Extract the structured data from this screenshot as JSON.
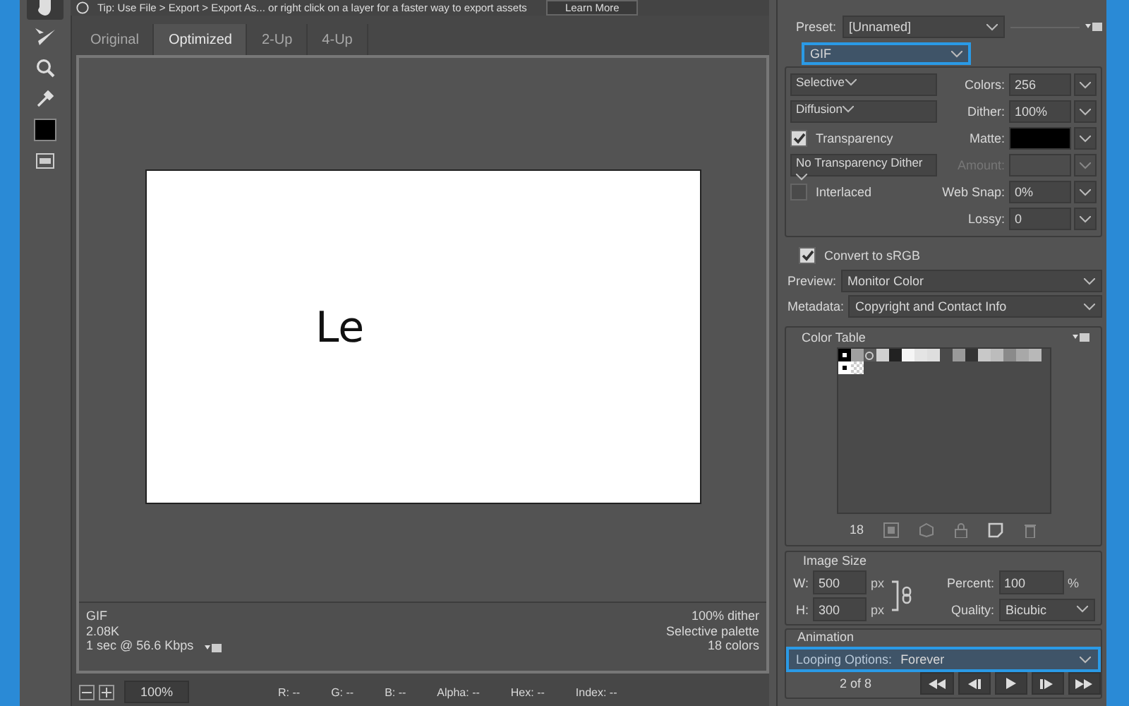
{
  "tip": {
    "text": "Tip: Use File > Export > Export As...  or right click on a layer for a faster way to export assets",
    "button": "Learn More"
  },
  "tools": [
    {
      "kind": "hand",
      "selected": true
    },
    {
      "kind": "slice",
      "selected": false
    },
    {
      "kind": "zoom",
      "selected": false
    },
    {
      "kind": "eyedropper",
      "selected": false
    },
    {
      "kind": "swatch",
      "selected": false
    },
    {
      "kind": "slices",
      "selected": false
    }
  ],
  "tabs": [
    {
      "label": "Original",
      "selected": false
    },
    {
      "label": "Optimized",
      "selected": true
    },
    {
      "label": "2-Up",
      "selected": false
    },
    {
      "label": "4-Up",
      "selected": false
    }
  ],
  "preview": {
    "text": "Le"
  },
  "info_left": [
    "GIF",
    "2.08K",
    "1 sec @ 56.6 Kbps"
  ],
  "info_right": [
    "100% dither",
    "Selective palette",
    "18 colors"
  ],
  "status": {
    "zoom": "100%",
    "readouts": [
      "R: --",
      "G: --",
      "B: --",
      "Alpha: --",
      "Hex: --",
      "Index: --"
    ]
  },
  "preset": {
    "label": "Preset:",
    "value": "[Unnamed]"
  },
  "format": {
    "value": "GIF",
    "focused": true
  },
  "reduction": "Selective",
  "colors": {
    "label": "Colors:",
    "value": "256"
  },
  "dither_method": "Diffusion",
  "dither": {
    "label": "Dither:",
    "value": "100%"
  },
  "transparency": {
    "label": "Transparency",
    "checked": true
  },
  "matte": {
    "label": "Matte:"
  },
  "transparency_dither": "No Transparency Dither",
  "amount": {
    "label": "Amount:",
    "disabled": true
  },
  "interlaced": {
    "label": "Interlaced",
    "checked": false
  },
  "web_snap": {
    "label": "Web Snap:",
    "value": "0%"
  },
  "lossy": {
    "label": "Lossy:",
    "value": "0"
  },
  "convert_srgb": {
    "label": "Convert to sRGB",
    "checked": true
  },
  "preview_mode": {
    "label": "Preview:",
    "value": "Monitor Color"
  },
  "metadata": {
    "label": "Metadata:",
    "value": "Copyright and Contact Info"
  },
  "color_table": {
    "title": "Color Table",
    "count": "18",
    "swatches": [
      {
        "color": "#000000",
        "kind": "marked"
      },
      {
        "color": "#a0a0a0",
        "kind": "plain"
      },
      {
        "color": "#5a5a5a",
        "kind": "ring"
      },
      {
        "color": "#d0d0d0",
        "kind": "plain"
      },
      {
        "color": "#222222",
        "kind": "plain"
      },
      {
        "color": "#f5f5f5",
        "kind": "plain"
      },
      {
        "color": "#e4e4e4",
        "kind": "plain"
      },
      {
        "color": "#dedede",
        "kind": "plain"
      },
      {
        "color": "#4a4a4a",
        "kind": "plain"
      },
      {
        "color": "#9a9a9a",
        "kind": "plain"
      },
      {
        "color": "#333333",
        "kind": "plain"
      },
      {
        "color": "#c8c8c8",
        "kind": "plain"
      },
      {
        "color": "#bcbcbc",
        "kind": "plain"
      },
      {
        "color": "#8a8a8a",
        "kind": "plain"
      },
      {
        "color": "#a8a8a8",
        "kind": "plain"
      },
      {
        "color": "#b8b8b8",
        "kind": "plain"
      },
      {
        "color": "#ffffff",
        "kind": "marked"
      },
      {
        "color": "#ffffff",
        "kind": "transparent"
      }
    ]
  },
  "image_size": {
    "title": "Image Size",
    "width": {
      "label": "W:",
      "value": "500",
      "unit": "px"
    },
    "height": {
      "label": "H:",
      "value": "300",
      "unit": "px"
    },
    "percent": {
      "label": "Percent:",
      "value": "100",
      "unit": "%"
    },
    "quality": {
      "label": "Quality:",
      "value": "Bicubic"
    }
  },
  "animation": {
    "title": "Animation",
    "looping": {
      "label": "Looping Options:",
      "value": "Forever",
      "focused": true
    },
    "frame": "2 of 8"
  }
}
